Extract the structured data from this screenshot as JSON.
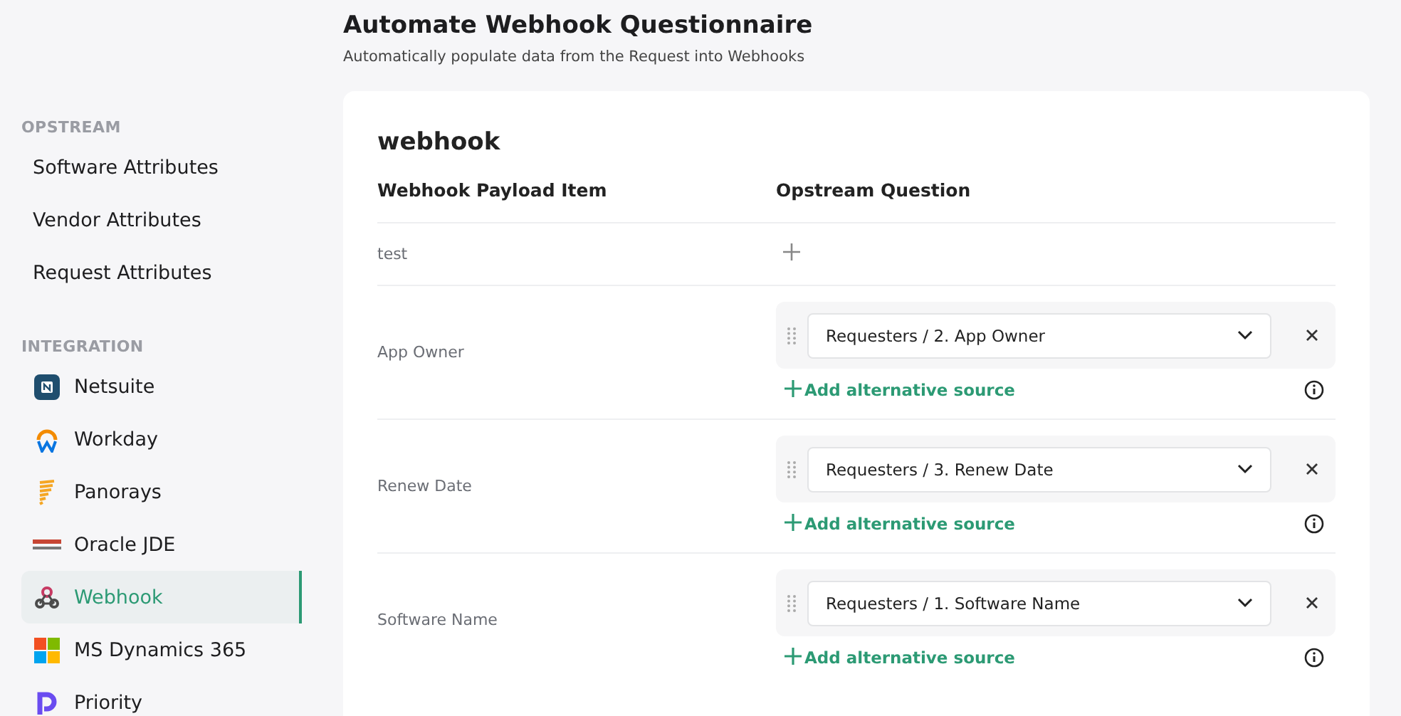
{
  "sidebar": {
    "sections": [
      {
        "heading": "OPSTREAM",
        "items": [
          {
            "label": "Software Attributes",
            "selected": false
          },
          {
            "label": "Vendor Attributes",
            "selected": false
          },
          {
            "label": "Request Attributes",
            "selected": false
          }
        ]
      },
      {
        "heading": "INTEGRATION",
        "items": [
          {
            "label": "Netsuite",
            "selected": false
          },
          {
            "label": "Workday",
            "selected": false
          },
          {
            "label": "Panorays",
            "selected": false
          },
          {
            "label": "Oracle JDE",
            "selected": false
          },
          {
            "label": "Webhook",
            "selected": true
          },
          {
            "label": "MS Dynamics 365",
            "selected": false
          },
          {
            "label": "Priority",
            "selected": false
          }
        ]
      }
    ]
  },
  "header": {
    "title": "Automate Webhook Questionnaire",
    "subtitle": "Automatically populate data from the Request into Webhooks"
  },
  "card": {
    "title": "webhook",
    "columns": [
      "Webhook Payload Item",
      "Opstream Question"
    ],
    "rows": [
      {
        "kind": "empty",
        "item": "test"
      },
      {
        "kind": "mapped",
        "item": "App Owner",
        "question": "Requesters / 2. App Owner",
        "add_label": "Add alternative source"
      },
      {
        "kind": "mapped",
        "item": "Renew Date",
        "question": "Requesters / 3. Renew Date",
        "add_label": "Add alternative source"
      },
      {
        "kind": "mapped",
        "item": "Software Name",
        "question": "Requesters / 1. Software Name",
        "add_label": "Add alternative source"
      }
    ]
  }
}
